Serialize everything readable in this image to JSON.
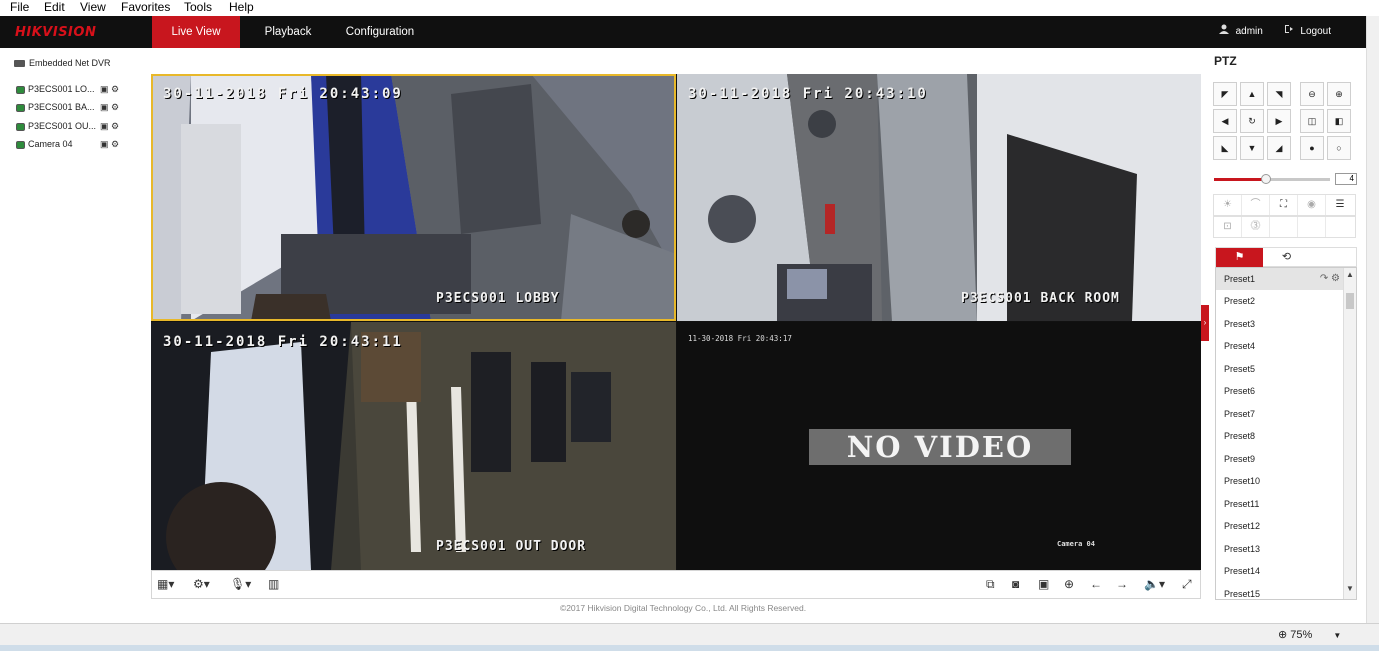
{
  "menu": [
    "File",
    "Edit",
    "View",
    "Favorites",
    "Tools",
    "Help"
  ],
  "header": {
    "logo": "HIKVISION",
    "tabs": [
      "Live View",
      "Playback",
      "Configuration"
    ],
    "active_tab": "Live View",
    "user": "admin",
    "logout": "Logout"
  },
  "sidebar": {
    "device": "Embedded Net DVR",
    "cameras": [
      "P3ECS001 LO...",
      "P3ECS001 BA...",
      "P3ECS001 OU...",
      "Camera 04"
    ]
  },
  "video": {
    "tiles": [
      {
        "timestamp": "30-11-2018 Fri 20:43:09",
        "name": "P3ECS001 LOBBY"
      },
      {
        "timestamp": "30-11-2018 Fri 20:43:10",
        "name": "P3ECS001 BACK ROOM"
      },
      {
        "timestamp": "30-11-2018 Fri 20:43:11",
        "name": "P3ECS001 OUT DOOR"
      },
      {
        "timestamp": "11-30-2018 Fri 20:43:17",
        "name": "Camera 04",
        "status": "NO VIDEO"
      }
    ]
  },
  "footer": "©2017 Hikvision Digital Technology Co., Ltd. All Rights Reserved.",
  "ptz": {
    "title": "PTZ",
    "speed": "4",
    "speed_level": 0.45,
    "presets": [
      "Preset1",
      "Preset2",
      "Preset3",
      "Preset4",
      "Preset5",
      "Preset6",
      "Preset7",
      "Preset8",
      "Preset9",
      "Preset10",
      "Preset11",
      "Preset12",
      "Preset13",
      "Preset14",
      "Preset15"
    ]
  },
  "statusbar": {
    "zoom": "75%"
  },
  "colors": {
    "accent": "#c8161e",
    "header": "#101010",
    "selection": "#e8b82a"
  }
}
